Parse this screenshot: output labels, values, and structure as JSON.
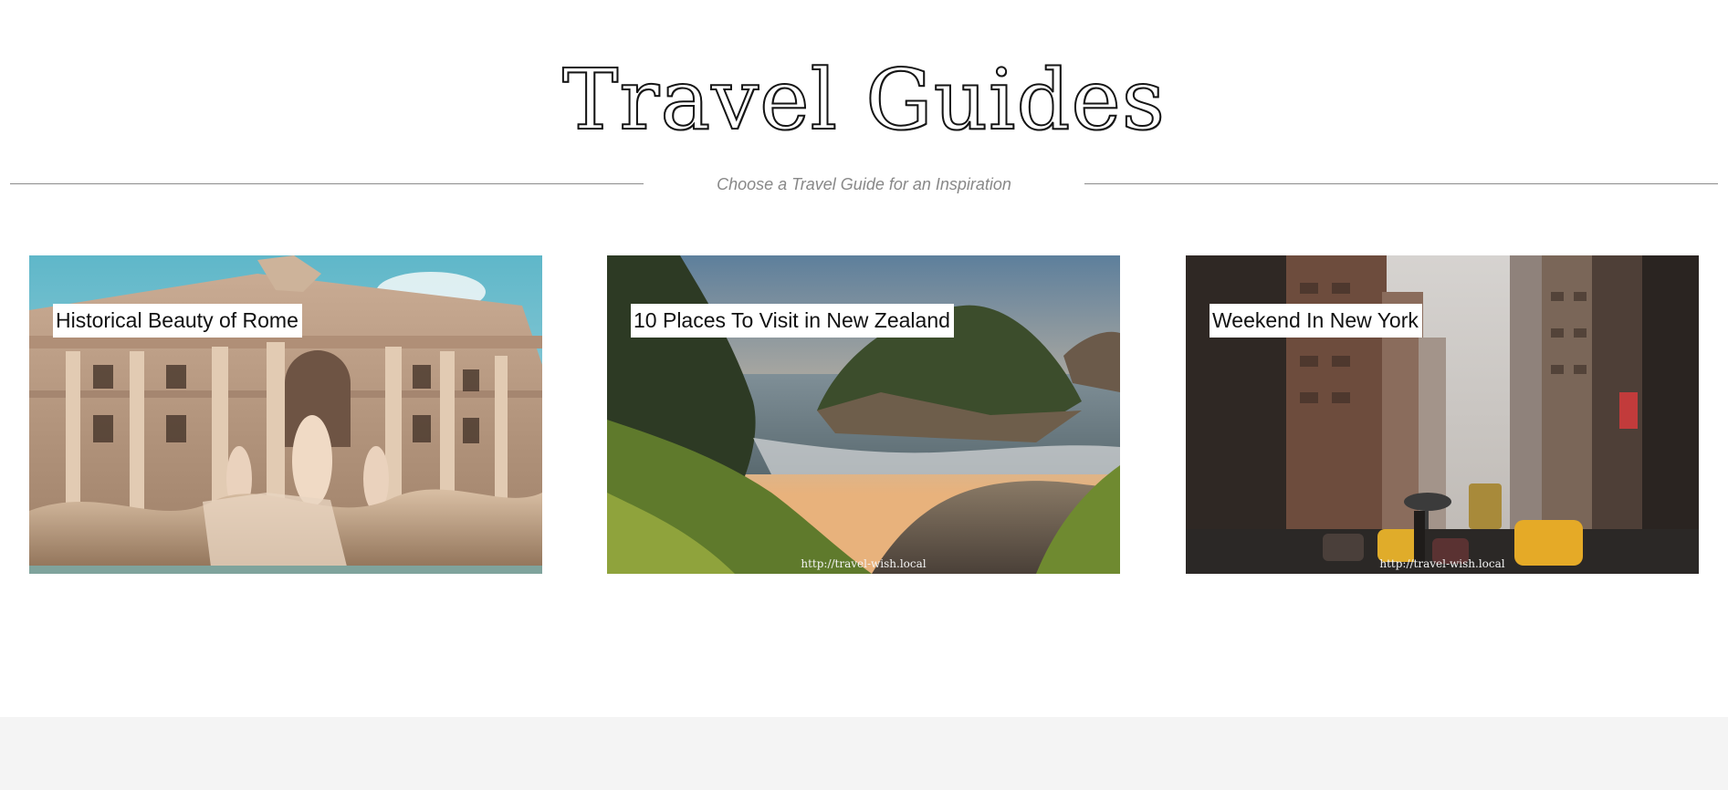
{
  "header": {
    "title": "Travel Guides",
    "subtitle": "Choose a Travel Guide for an Inspiration"
  },
  "guides": [
    {
      "title": "Historical Beauty of Rome",
      "image": "trevi-fountain-photo",
      "url": ""
    },
    {
      "title": "10 Places To Visit in New Zealand",
      "image": "coastal-cove-photo",
      "url": "http://travel-wish.local"
    },
    {
      "title": "Weekend In New York",
      "image": "city-street-photo",
      "url": "http://travel-wish.local"
    }
  ],
  "colors": {
    "divider": "#8c8c8c",
    "subtitle": "#888888",
    "footer": "#f4f4f4",
    "title_outline": "#151515"
  }
}
